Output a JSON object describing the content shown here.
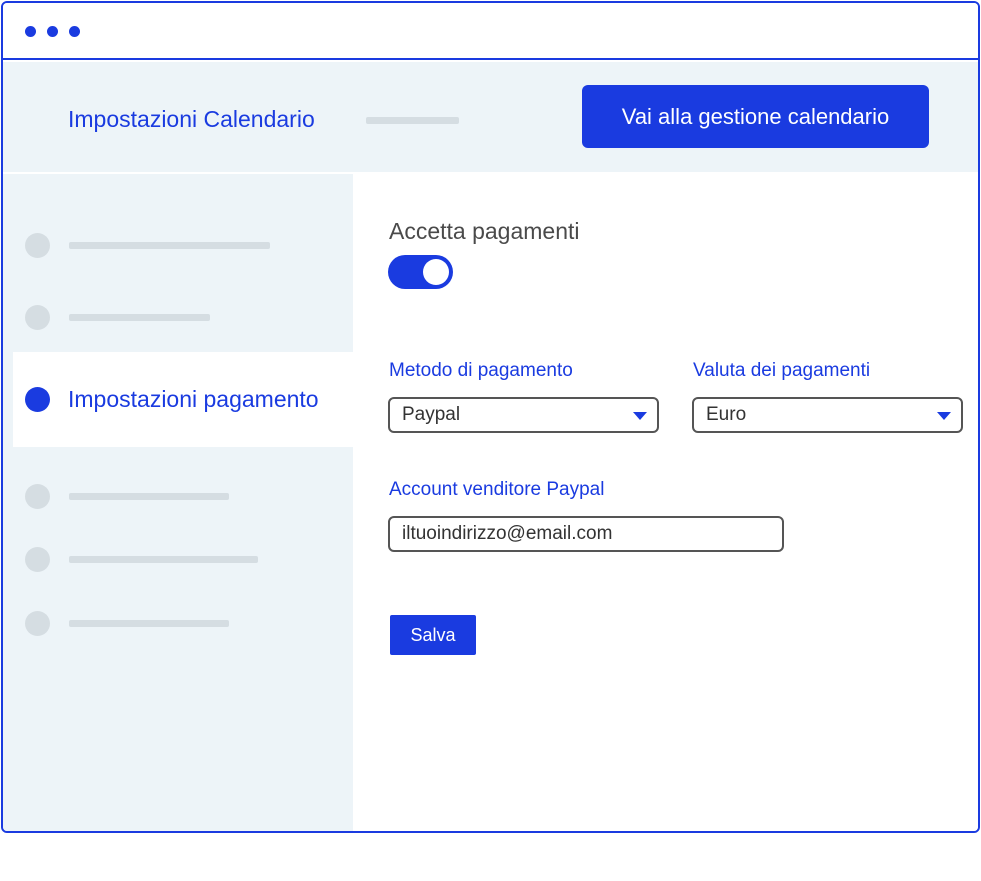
{
  "header": {
    "title": "Impostazioni Calendario",
    "manage_button_label": "Vai alla gestione calendario"
  },
  "sidebar": {
    "active_item_label": "Impostazioni pagamento"
  },
  "payments": {
    "accept_label": "Accetta pagamenti",
    "accept_enabled": true,
    "method_label": "Metodo di pagamento",
    "method_value": "Paypal",
    "currency_label": "Valuta dei pagamenti",
    "currency_value": "Euro",
    "account_label": "Account venditore Paypal",
    "account_value": "iltuoindirizzo@email.com",
    "save_label": "Salva"
  },
  "colors": {
    "accent": "#1a3be0",
    "panel_background": "#edf4f8",
    "placeholder": "#d5dde2"
  },
  "icons": [
    "window-dot-icon",
    "chevron-down-icon",
    "toggle-switch"
  ]
}
